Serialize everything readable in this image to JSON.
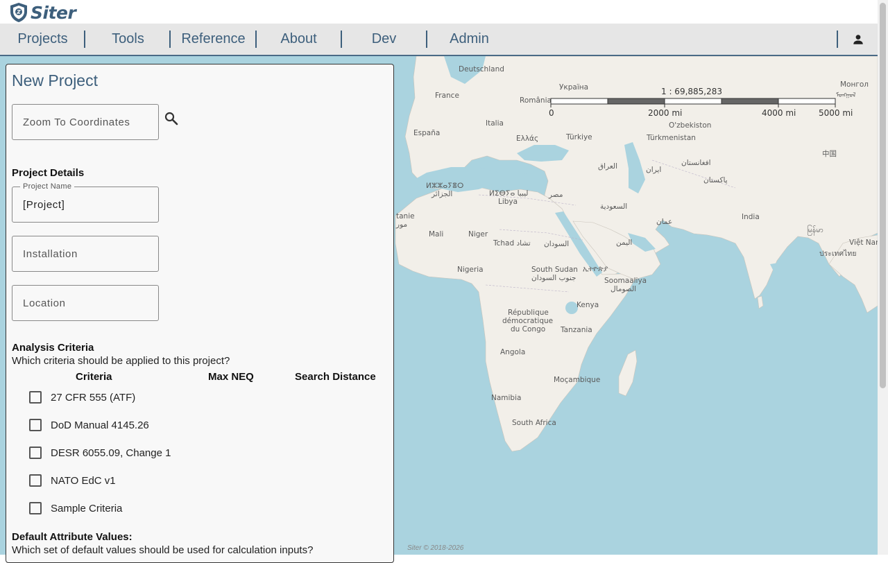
{
  "app": {
    "name": "Siter",
    "logo_icon": "shield-logo-icon"
  },
  "nav": {
    "items": [
      {
        "id": "projects",
        "label": "Projects"
      },
      {
        "id": "tools",
        "label": "Tools"
      },
      {
        "id": "reference",
        "label": "Reference"
      },
      {
        "id": "about",
        "label": "About"
      },
      {
        "id": "dev",
        "label": "Dev"
      },
      {
        "id": "admin",
        "label": "Admin"
      }
    ],
    "user_icon": "person-icon"
  },
  "panel": {
    "title": "New Project",
    "zoom": {
      "placeholder": "Zoom To Coordinates",
      "icon": "search-icon"
    },
    "project_details": {
      "heading": "Project Details",
      "project_name": {
        "label": "Project Name",
        "value": "[Project]"
      },
      "installation": {
        "placeholder": "Installation"
      },
      "location": {
        "placeholder": "Location"
      }
    },
    "analysis": {
      "heading": "Analysis Criteria",
      "question": "Which criteria should be applied to this project?",
      "columns": [
        "Criteria",
        "Max NEQ",
        "Search Distance"
      ],
      "criteria": [
        {
          "label": "27 CFR 555 (ATF)",
          "checked": false
        },
        {
          "label": "DoD Manual 4145.26",
          "checked": false
        },
        {
          "label": "DESR 6055.09, Change 1",
          "checked": false
        },
        {
          "label": "NATO EdC v1",
          "checked": false
        },
        {
          "label": "Sample Criteria",
          "checked": false
        }
      ]
    },
    "defaults": {
      "heading": "Default Attribute Values:",
      "question": "Which set of default values should be used for calculation inputs?"
    }
  },
  "map": {
    "scale_ratio": "1 : 69,885,283",
    "scale_ticks": [
      "0",
      "2000 mi",
      "4000 mi",
      "5000 mi"
    ],
    "attribution": "Siter © 2018-2026",
    "colors": {
      "water": "#aad3df",
      "land": "#f2efe9",
      "accent": "#3d5f7c"
    },
    "labels": [
      "Deutschland",
      "France",
      "România",
      "Україна",
      "España",
      "Italia",
      "Ελλάς",
      "Türkiye",
      "O'zbekiston",
      "Türkmenistan",
      "العراق",
      "ایران",
      "افغانستان",
      "پاکستان",
      "India",
      "ⵍⵣⵣⴰⵢⴻⵔ",
      "الجزائر",
      "ⵍⵉⴱⵢⴰ ليبيا",
      "Libya",
      "مصر",
      "السعودية",
      "عمان",
      "tanie",
      "مور",
      "Mali",
      "Niger",
      "Tchad تشاد",
      "السودان",
      "اليمن",
      "Nigeria",
      "South Sudan",
      "جنوب السودان",
      "ኢትዮጵያ",
      "Soomaaliya",
      "الصومال",
      "Kenya",
      "République",
      "démocratique",
      "du Congo",
      "Tanzania",
      "Angola",
      "Moçambique",
      "Namibia",
      "South Africa",
      "中国",
      "Монгол",
      "ᠮᠣᠩᠭᠣᠯ",
      "မြန်မာ",
      "Việt Nam",
      "ประเทศไทย"
    ]
  }
}
